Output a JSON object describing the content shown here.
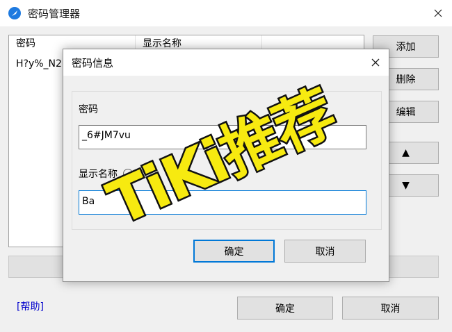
{
  "main_window": {
    "title": "密码管理器",
    "list": {
      "columns": [
        "密码",
        "显示名称",
        ""
      ],
      "rows": [
        [
          "H?y%_N2I",
          "",
          ""
        ]
      ]
    },
    "side_buttons": {
      "add": "添加",
      "delete": "删除",
      "edit": "编辑",
      "up": "▲",
      "down": "▼"
    },
    "help_link": "[帮助]",
    "ok": "确定",
    "cancel": "取消"
  },
  "dialog": {
    "title": "密码信息",
    "password_label": "密码",
    "password_value": "_6#JM7vu",
    "display_label": "显示名称",
    "display_value": "Ba",
    "ok": "确定",
    "cancel": "取消"
  },
  "watermark": "TiKi推荐",
  "colors": {
    "accent": "#0078d7",
    "app_icon": "#1e7ae0",
    "watermark_fill": "#f7ea10",
    "watermark_stroke": "#111111"
  }
}
